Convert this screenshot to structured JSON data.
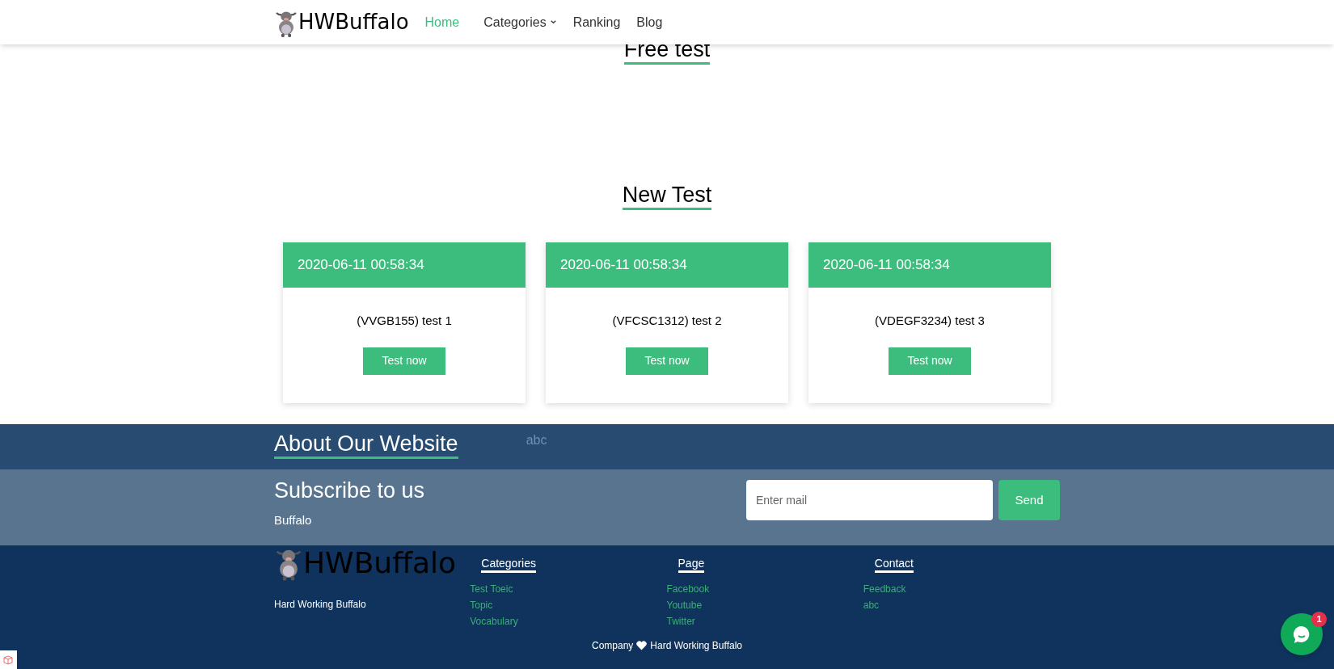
{
  "header": {
    "brand": "HWBuffalo",
    "nav": [
      {
        "label": "Home",
        "selected": true,
        "dropdown": false
      },
      {
        "label": "Categories",
        "selected": false,
        "dropdown": true
      },
      {
        "label": "Ranking",
        "selected": false,
        "dropdown": false
      },
      {
        "label": "Blog",
        "selected": false,
        "dropdown": false
      }
    ]
  },
  "free_test": {
    "title": "Free test"
  },
  "new_test": {
    "title": "New Test",
    "cards": [
      {
        "date": "2020-06-11 00:58:34",
        "name": "(VVGB155) test 1",
        "button": "Test now"
      },
      {
        "date": "2020-06-11 00:58:34",
        "name": "(VFCSC1312) test 2",
        "button": "Test now"
      },
      {
        "date": "2020-06-11 00:58:34",
        "name": "(VDEGF3234) test 3",
        "button": "Test now"
      }
    ]
  },
  "about": {
    "title": "About Our Website",
    "text": "abc"
  },
  "subscribe": {
    "title": "Subscribe to us",
    "subtitle": "Buffalo",
    "placeholder": "Enter mail",
    "button": "Send"
  },
  "footer": {
    "brand": "HWBuffalo",
    "tagline": "Hard Working Buffalo",
    "columns": [
      {
        "title": "Categories",
        "links": [
          "Test Toeic",
          "Topic",
          "Vocabulary"
        ]
      },
      {
        "title": "Page",
        "links": [
          "Facebook",
          "Youtube",
          "Twitter"
        ]
      },
      {
        "title": "Contact",
        "links": [
          "Feedback",
          "abc"
        ]
      }
    ],
    "copyright_left": "Company",
    "copyright_right": "Hard Working Buffalo"
  },
  "chat": {
    "badge": "1"
  }
}
